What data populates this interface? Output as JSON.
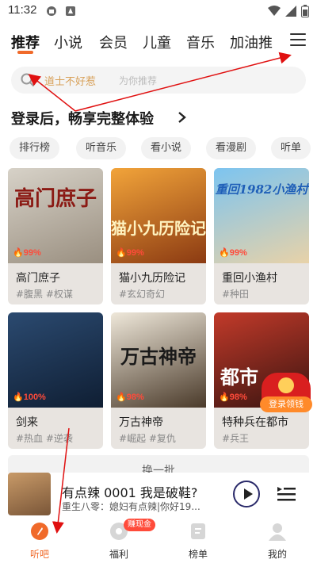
{
  "status_bar": {
    "time": "11:32"
  },
  "tabs": [
    "推荐",
    "小说",
    "会员",
    "儿童",
    "音乐",
    "加油推"
  ],
  "search": {
    "hot_word": "道士不好惹",
    "placeholder": "为你推荐"
  },
  "login_prompt": "登录后，畅享完整体验",
  "chips": [
    "排行榜",
    "听音乐",
    "看小说",
    "看漫剧",
    "听单"
  ],
  "books": [
    {
      "title": "高门庶子",
      "tags": "#腹黑 #权谋",
      "heat": "99%",
      "cover_text": "高门庶子",
      "cover_colors": [
        "#d7d2c8",
        "#9a8f80"
      ],
      "cover_text_color": "#8b1a14"
    },
    {
      "title": "猫小九历险记",
      "tags": "#玄幻奇幻",
      "heat": "99%",
      "cover_text": "猫小九历险记",
      "cover_colors": [
        "#f2a43a",
        "#8b3a12"
      ],
      "cover_text_color": "#fff3c0"
    },
    {
      "title": "重回小渔村",
      "tags": "#种田",
      "heat": "99%",
      "cover_text": "重回1982小渔村",
      "cover_colors": [
        "#7cc4f0",
        "#e8d2a8"
      ],
      "cover_text_color": "#1f5fb8"
    },
    {
      "title": "剑来",
      "tags": "#热血 #逆袭",
      "heat": "100%",
      "cover_text": "",
      "cover_colors": [
        "#2b4a70",
        "#0f1e33"
      ],
      "cover_text_color": "#dfe8f5"
    },
    {
      "title": "万古神帝",
      "tags": "#崛起 #复仇",
      "heat": "98%",
      "cover_text": "万古神帝",
      "cover_colors": [
        "#efe8da",
        "#4a3a2a"
      ],
      "cover_text_color": "#1a1a1a"
    },
    {
      "title": "特种兵在都市",
      "tags": "#兵王",
      "heat": "98%",
      "cover_text": "都市",
      "cover_colors": [
        "#c23a2a",
        "#3a1410"
      ],
      "cover_text_color": "#ffffff"
    }
  ],
  "refresh_label": "换一批",
  "red_packet_label": "登录领钱",
  "player": {
    "title": "有点辣 0001 我是破鞋?",
    "subtitle": "重生八零：媳妇有点辣|你好19..."
  },
  "nav": [
    {
      "label": "听吧",
      "icon": "listen-icon",
      "active": true
    },
    {
      "label": "福利",
      "icon": "gift-icon",
      "active": false
    },
    {
      "label": "榜单",
      "icon": "ranking-icon",
      "active": false
    },
    {
      "label": "我的",
      "icon": "profile-icon",
      "active": false
    }
  ],
  "nav_badge": "赚现金",
  "colors": {
    "accent": "#f06a2a",
    "annotation": "#e01010"
  }
}
